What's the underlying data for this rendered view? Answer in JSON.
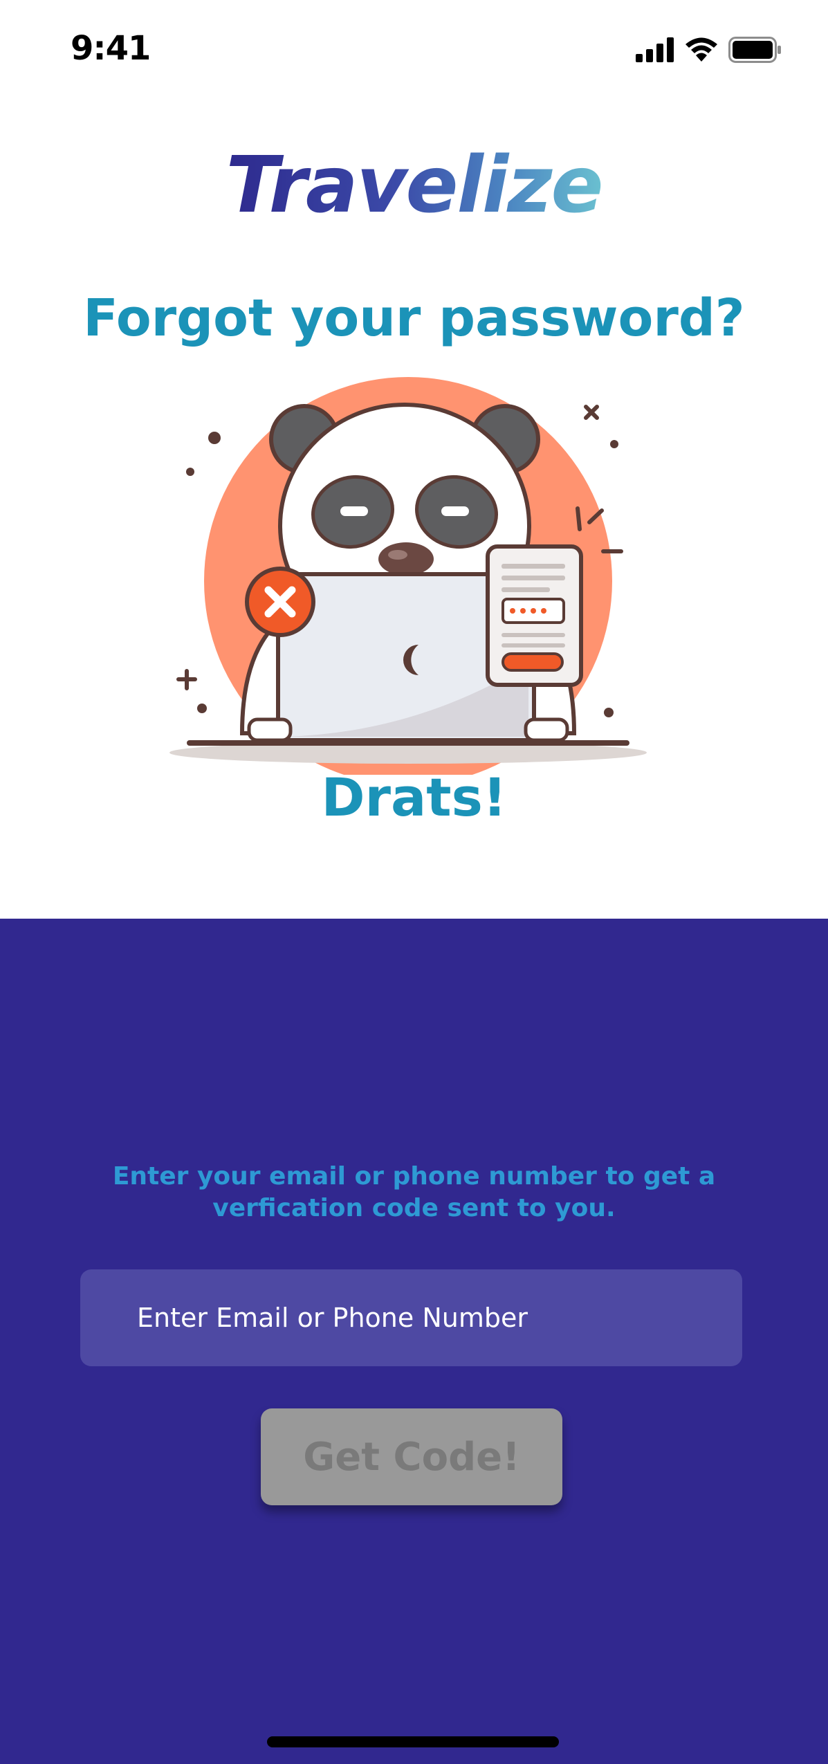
{
  "status_bar": {
    "time": "9:41",
    "icons": [
      "cellular-signal-icon",
      "wifi-icon",
      "battery-icon"
    ]
  },
  "brand": {
    "logo_text": "Travelize"
  },
  "header": {
    "title": "Forgot your password?"
  },
  "illustration": {
    "subject": "panda-laptop-error-illustration"
  },
  "message": {
    "title": "Drats!"
  },
  "form": {
    "instruction": "Enter your email or phone number to get a verfication code sent to you.",
    "email_input": {
      "value": "",
      "placeholder": "Enter Email or Phone Number"
    },
    "submit_label": "Get Code!"
  },
  "colors": {
    "accent": "#1b93b8",
    "panel": "#31288f",
    "input_bg": "#4e49a3",
    "button_disabled": "#999999"
  }
}
